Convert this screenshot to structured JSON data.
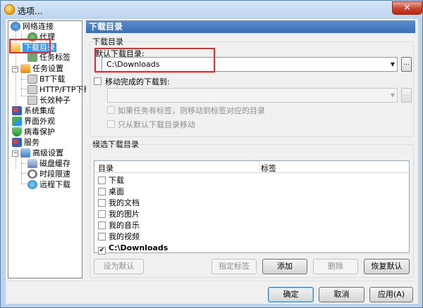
{
  "window": {
    "title": "选项..."
  },
  "tree": {
    "items": [
      {
        "label": "网络连接"
      },
      {
        "label": "代理"
      },
      {
        "label": "下载目录"
      },
      {
        "label": "任务标签"
      },
      {
        "label": "任务设置"
      },
      {
        "label": "BT下载"
      },
      {
        "label": "HTTP/FTP下载"
      },
      {
        "label": "长效种子"
      },
      {
        "label": "系统集成"
      },
      {
        "label": "界面外观"
      },
      {
        "label": "病毒保护"
      },
      {
        "label": "服务"
      },
      {
        "label": "高级设置"
      },
      {
        "label": "磁盘缓存"
      },
      {
        "label": "时段限速"
      },
      {
        "label": "远程下载"
      }
    ]
  },
  "panel": {
    "title": "下载目录",
    "section1": "下载目录",
    "default_dir_label": "默认下载目录:",
    "default_dir_value": "C:\\Downloads",
    "move_completed_label": "移动完成的下载到:",
    "move_completed_value": "",
    "opt_tag_move": "如果任务有标签，则移动到标签对应的目录",
    "opt_only_default": "只从默认下载目录移动",
    "section2": "候选下载目录",
    "list_headers": [
      "目录",
      "标签"
    ],
    "list_rows": [
      {
        "label": "下载",
        "checked": false
      },
      {
        "label": "桌面",
        "checked": false
      },
      {
        "label": "我的文档",
        "checked": false
      },
      {
        "label": "我的图片",
        "checked": false
      },
      {
        "label": "我的音乐",
        "checked": false
      },
      {
        "label": "我的视频",
        "checked": false
      },
      {
        "label": "C:\\Downloads",
        "checked": true
      }
    ],
    "buttons": {
      "set_default": "设为默认",
      "assign_tag": "指定标签",
      "add": "添加",
      "delete": "删除",
      "restore_default": "恢复默认"
    }
  },
  "footer": {
    "ok": "确定",
    "cancel": "取消",
    "apply": "应用(A)"
  },
  "browse_glyph": "...",
  "colors": {
    "accent": "#3b6fb6",
    "highlight": "#e8292e"
  }
}
